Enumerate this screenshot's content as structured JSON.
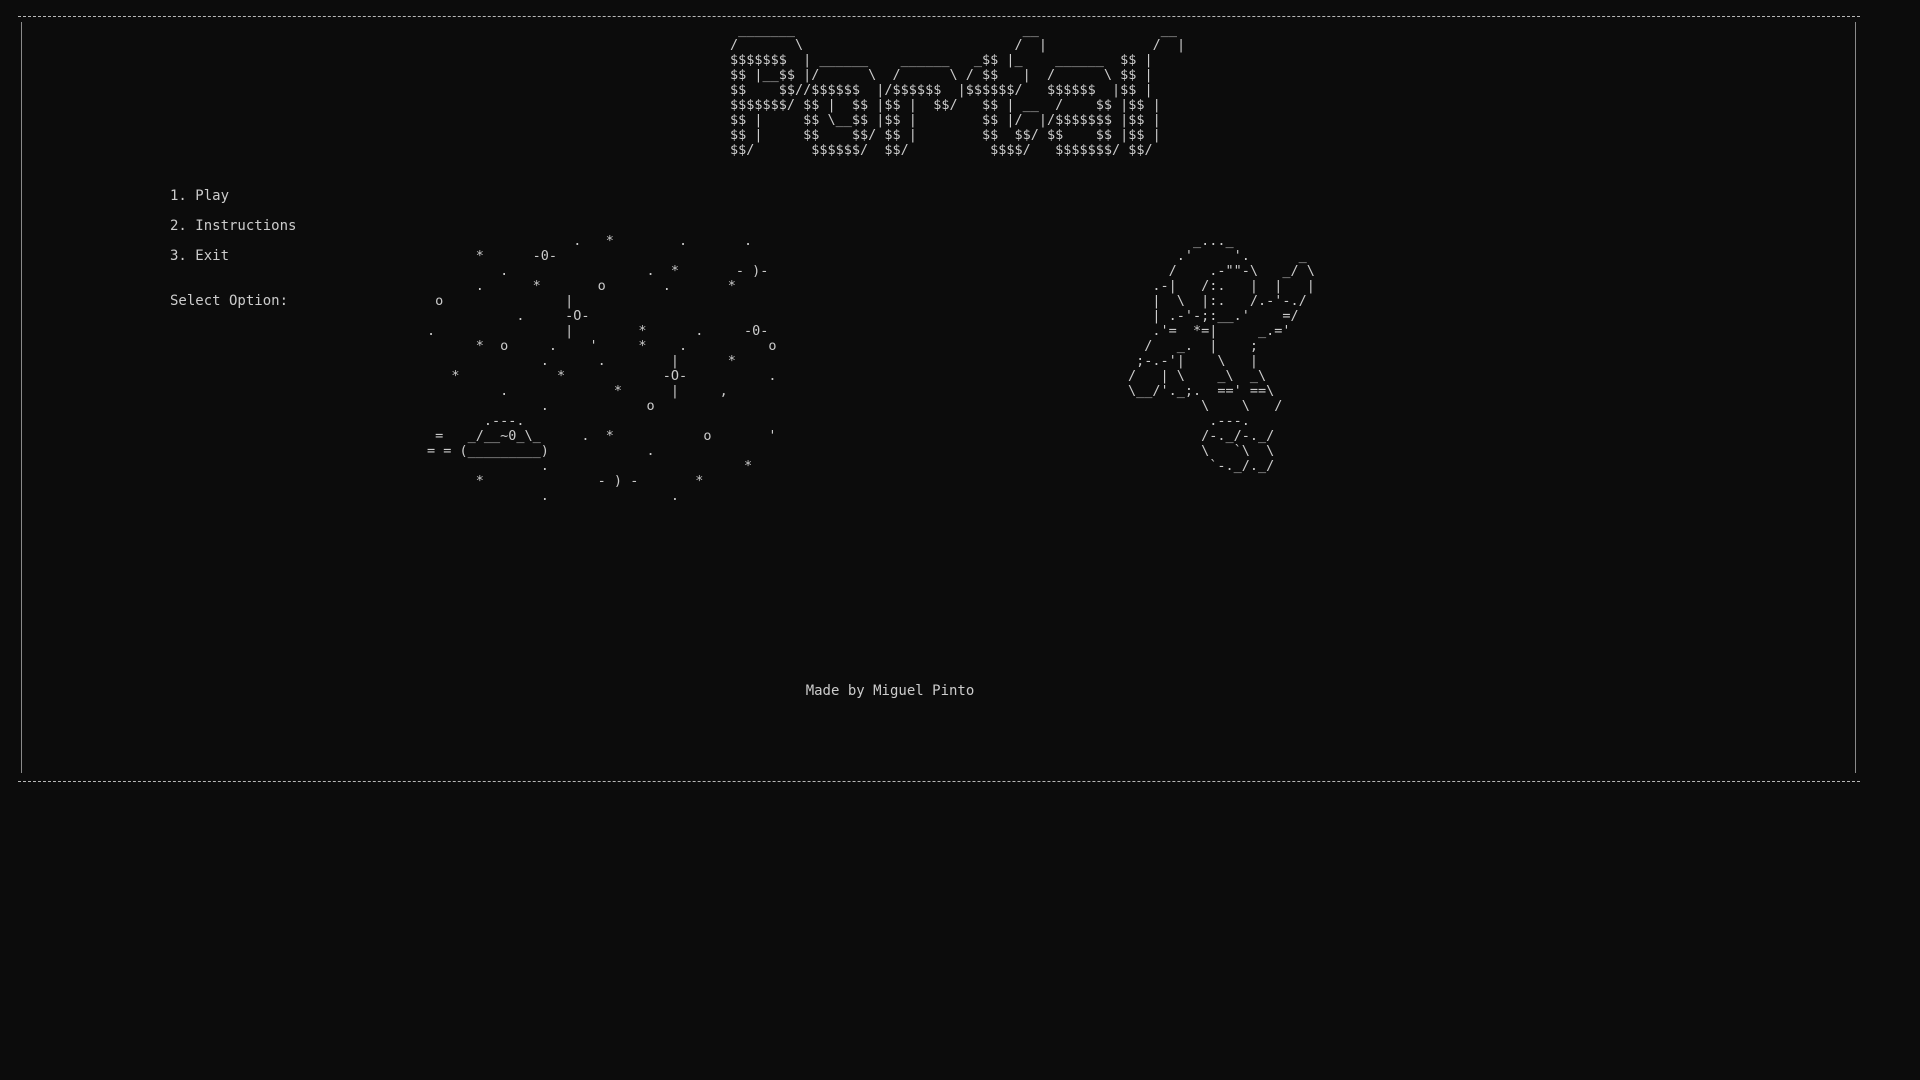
{
  "logo_art": " _______                            __               __\n/       \\                          /  |             /  |\n$$$$$$$  | ______    ______   _$$ |_    ______  $$ |\n$$ |__$$ |/      \\  /      \\ / $$   |  /      \\ $$ |\n$$    $$//$$$$$$  |/$$$$$$  |$$$$$$/   $$$$$$  |$$ |\n$$$$$$$/ $$ |  $$ |$$ |  $$/   $$ | __  /    $$ |$$ |\n$$ |     $$ \\__$$ |$$ |        $$ |/  |/$$$$$$$ |$$ |\n$$ |     $$    $$/ $$ |        $$  $$/ $$    $$ |$$ |\n$$/       $$$$$$/  $$/          $$$$/   $$$$$$$/ $$/",
  "menu": {
    "items": [
      {
        "label": "1. Play"
      },
      {
        "label": "2. Instructions"
      },
      {
        "label": "3. Exit"
      }
    ],
    "prompt": "Select Option:"
  },
  "space_art": "                  .   *        .       .\n      *      -0-\n         .                 .  *       - )-\n      .      *       o       .       *\n o               |\n           .     -O-\n.                |        *      .     -0-\n      *  o     .    '     *    .          o\n              .      .        |      *\n   *            *            -O-          .\n         .             *      |     ,\n              .            o\n       .---.\n =   _/__~0_\\_     .  *           o       '\n= = (_________)            .\n              .                        *\n      *              - ) -       *\n              .               .",
  "astronaut_art": "        _..._\n      .'     '.      _\n     /    .-\"\"-\\   _/ \\\n   .-|   /:.   |  |   |\n   |  \\  |:.   /.-'-./\n   | .-'-;:__.'    =/\n   .'=  *=|     _.='\n  /   _.  |    ;\n ;-.-'|    \\   |\n/   | \\    _\\  _\\\n\\__/'._;.  ==' ==\\\n         \\    \\   /\n          .---.\n         /-._/-._/\n         \\   `\\  \\\n          `-._/._/",
  "credits": "Made by Miguel Pinto"
}
